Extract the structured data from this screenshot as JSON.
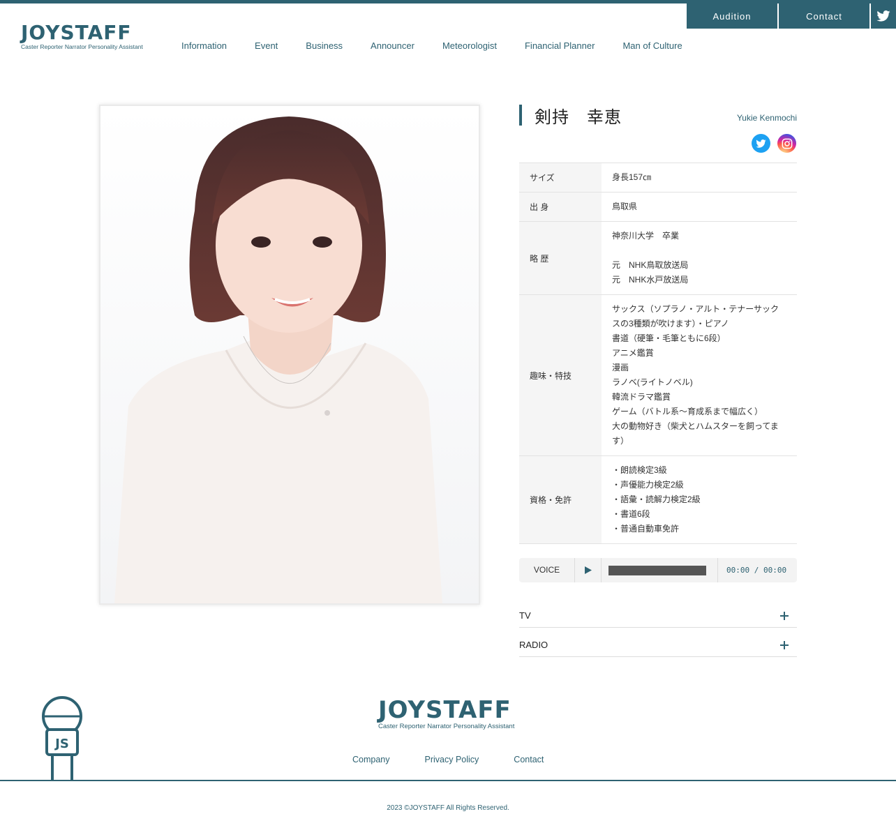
{
  "header": {
    "logo_main": "JOYSTAFF",
    "logo_sub": "Caster Reporter Narrator Personality Assistant",
    "audition_label": "Audition",
    "contact_label": "Contact",
    "twitter_icon": "twitter-icon"
  },
  "nav": {
    "items": [
      "Information",
      "Event",
      "Business",
      "Announcer",
      "Meteorologist",
      "Financial Planner",
      "Man of Culture"
    ]
  },
  "profile": {
    "name_jp": "剣持　幸恵",
    "name_en": "Yukie Kenmochi",
    "social": [
      "twitter-icon",
      "instagram-icon"
    ],
    "rows": [
      {
        "label": "サイズ",
        "lines": [
          "身長157㎝"
        ]
      },
      {
        "label": "出 身",
        "lines": [
          "鳥取県"
        ]
      },
      {
        "label": "略 歴",
        "lines": [
          "神奈川大学　卒業",
          "",
          "元　NHK鳥取放送局",
          "元　NHK水戸放送局"
        ]
      },
      {
        "label": "趣味・特技",
        "lines": [
          "サックス（ソプラノ・アルト・テナーサックスの3種類が吹けます）・ピアノ",
          "書道（硬筆・毛筆ともに6段）",
          "アニメ鑑賞",
          "漫画",
          "ラノベ(ライトノベル)",
          "韓流ドラマ鑑賞",
          "ゲーム（バトル系～育成系まで幅広く）",
          "大の動物好き（柴犬とハムスターを飼ってます）"
        ]
      },
      {
        "label": "資格・免許",
        "lines": [
          "・朗読検定3級",
          "・声優能力検定2級",
          "・語彙・読解力検定2級",
          "・書道6段",
          "・普通自動車免許"
        ]
      }
    ]
  },
  "voice": {
    "label": "VOICE",
    "time": "00:00 / 00:00",
    "progress": 0
  },
  "accordions": {
    "tv": "TV",
    "radio": "RADIO"
  },
  "footer": {
    "logo_main": "JOYSTAFF",
    "logo_sub": "Caster Reporter Narrator Personality Assistant",
    "mic_label": "JS",
    "links": [
      "Company",
      "Privacy Policy",
      "Contact"
    ],
    "copyright": "2023 ©JOYSTAFF All Rights Reserved."
  },
  "colors": {
    "brand": "#2e6272",
    "twitter": "#1da1f2"
  }
}
